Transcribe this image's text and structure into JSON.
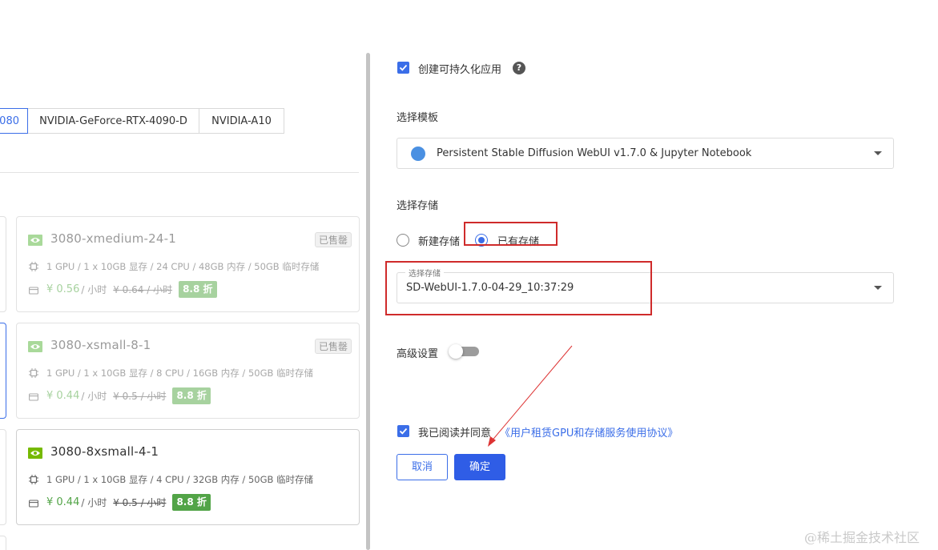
{
  "gpu_tabs": [
    "080",
    "NVIDIA-GeForce-RTX-4090-D",
    "NVIDIA-A10"
  ],
  "cards": [
    {
      "name": "3080-xmedium-24-1",
      "badge": "已售罄",
      "spec": "1 GPU / 1 x 10GB 显存 / 24 CPU / 48GB 内存 / 50GB 临时存储",
      "price": "¥ 0.56",
      "unit": "/ 小时",
      "original_price": "¥ 0.64 / 小时",
      "discount": "8.8 折"
    },
    {
      "name": "3080-xsmall-8-1",
      "badge": "已售罄",
      "spec": "1 GPU / 1 x 10GB 显存 / 8 CPU / 16GB 内存 / 50GB 临时存储",
      "price": "¥ 0.44",
      "unit": "/ 小时",
      "original_price": "¥ 0.5 / 小时",
      "discount": "8.8 折"
    },
    {
      "name": "3080-8xsmall-4-1",
      "badge": "",
      "spec": "1 GPU / 1 x 10GB 显存 / 4 CPU / 32GB 内存 / 50GB 临时存储",
      "price": "¥ 0.44",
      "unit": "/ 小时",
      "original_price": "¥ 0.5 / 小时",
      "discount": "8.8 折"
    }
  ],
  "persistent": {
    "label": "创建可持久化应用",
    "checked": true,
    "help_icon": "?"
  },
  "template": {
    "section_label": "选择模板",
    "value": "Persistent Stable Diffusion WebUI v1.7.0 & Jupyter Notebook"
  },
  "storage": {
    "section_label": "选择存储",
    "option_new": "新建存储",
    "option_existing": "已有存储",
    "selected": "existing",
    "select_label": "选择存储",
    "select_value": "SD-WebUI-1.7.0-04-29_10:37:29"
  },
  "advanced": {
    "label": "高级设置",
    "enabled": false
  },
  "agreement": {
    "label": "我已阅读并同意",
    "link": "《用户租赁GPU和存储服务使用协议》",
    "checked": true
  },
  "buttons": {
    "cancel": "取消",
    "confirm": "确定"
  },
  "watermark": "@稀土掘金技术社区",
  "colors": {
    "primary": "#3b6ee8",
    "price_green": "#52a447",
    "annotation_red": "#cf2b2b"
  }
}
